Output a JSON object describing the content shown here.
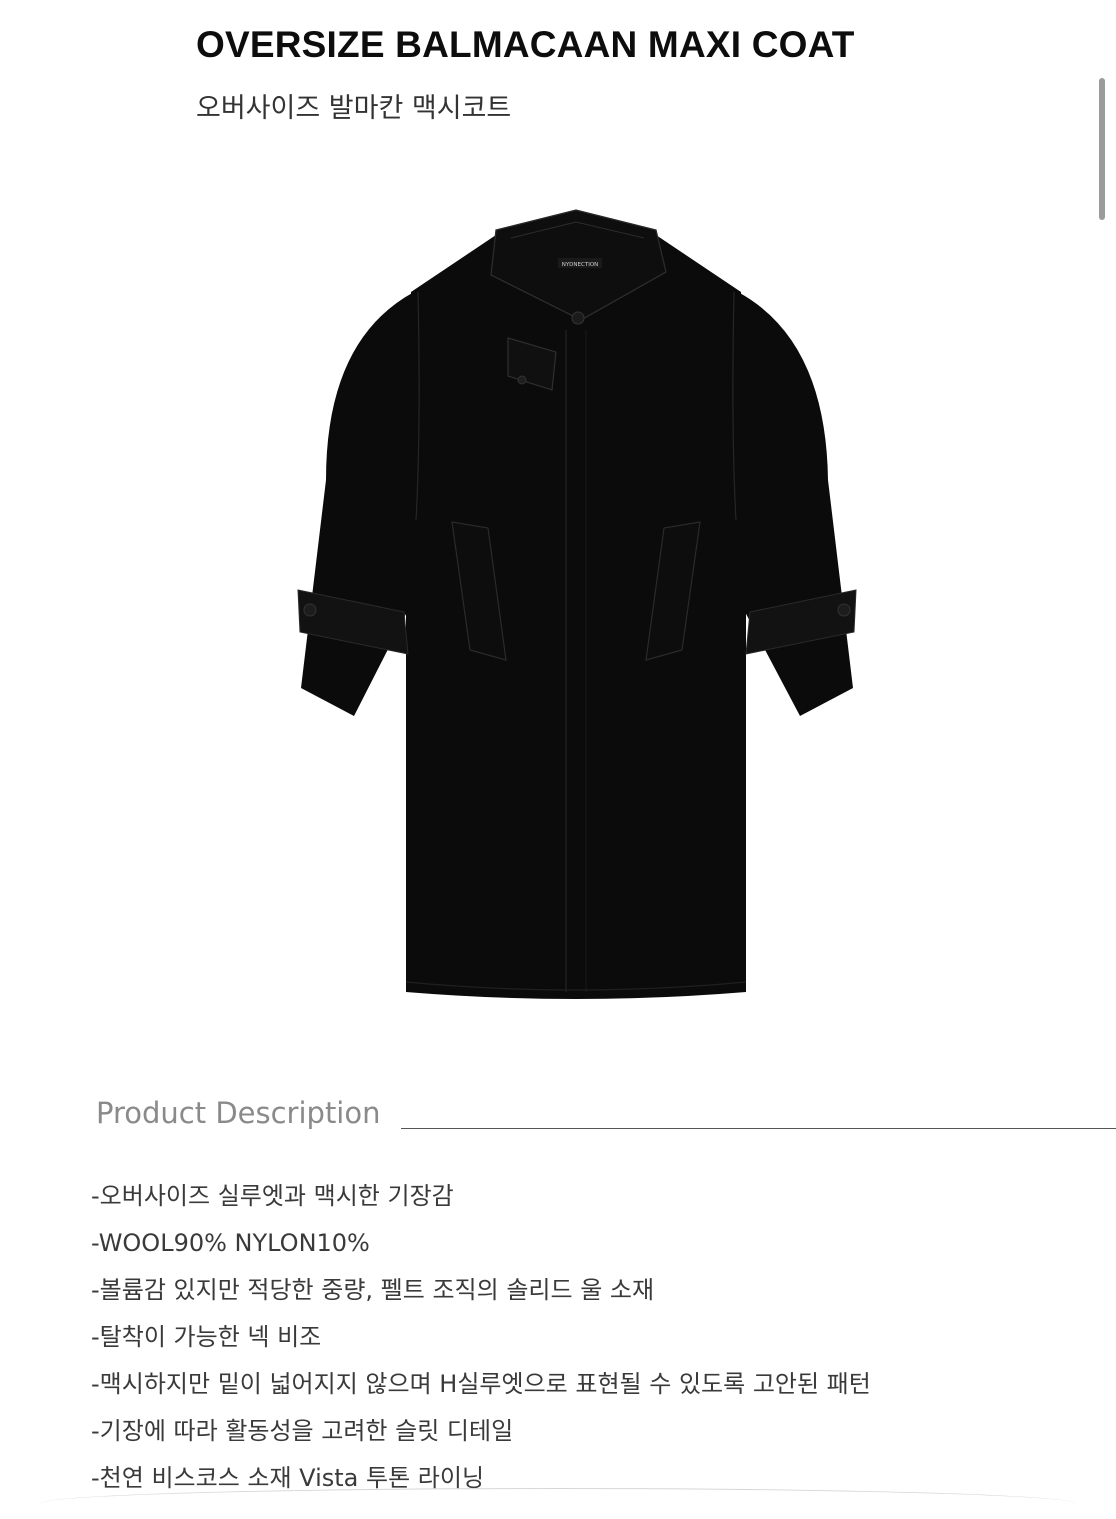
{
  "product": {
    "title": "OVERSIZE BALMACAAN MAXI COAT",
    "subtitle": "오버사이즈 발마칸 맥시코트",
    "label_text": "NYDNECTION"
  },
  "description": {
    "heading": "Product Description",
    "items": [
      "-오버사이즈 실루엣과 맥시한 기장감",
      "-WOOL90% NYLON10%",
      "-볼륨감 있지만 적당한 중량, 펠트 조직의 솔리드 울 소재",
      "-탈착이 가능한 넥 비조",
      "-맥시하지만 밑이 넓어지지 않으며 H실루엣으로 표현될 수 있도록 고안된 패턴",
      "-기장에 따라 활동성을 고려한 슬릿 디테일",
      "-천연 비스코스 소재 Vista 투톤 라이닝"
    ]
  },
  "colors": {
    "coat": "#0b0b0b",
    "heading_gray": "#8a8a8a",
    "body_text": "#3a3a3a",
    "scrollbar": "#9b9b9b"
  }
}
